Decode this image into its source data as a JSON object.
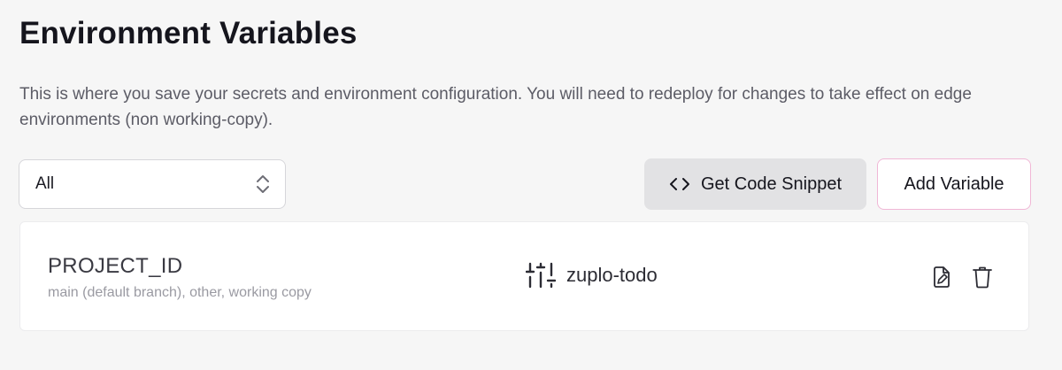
{
  "page": {
    "title": "Environment Variables",
    "description": "This is where you save your secrets and environment configuration. You will need to redeploy for changes to take effect on edge environments (non working-copy)."
  },
  "toolbar": {
    "filter_value": "All",
    "snippet_label": "Get Code Snippet",
    "add_label": "Add Variable"
  },
  "variables": [
    {
      "name": "PROJECT_ID",
      "branches": "main (default branch), other, working copy",
      "value": "zuplo-todo",
      "value_icon": "sliders-icon"
    }
  ],
  "colors": {
    "accent_border": "#f0b7d6",
    "background": "#f6f6f6",
    "secondary_button": "#e2e2e4"
  }
}
